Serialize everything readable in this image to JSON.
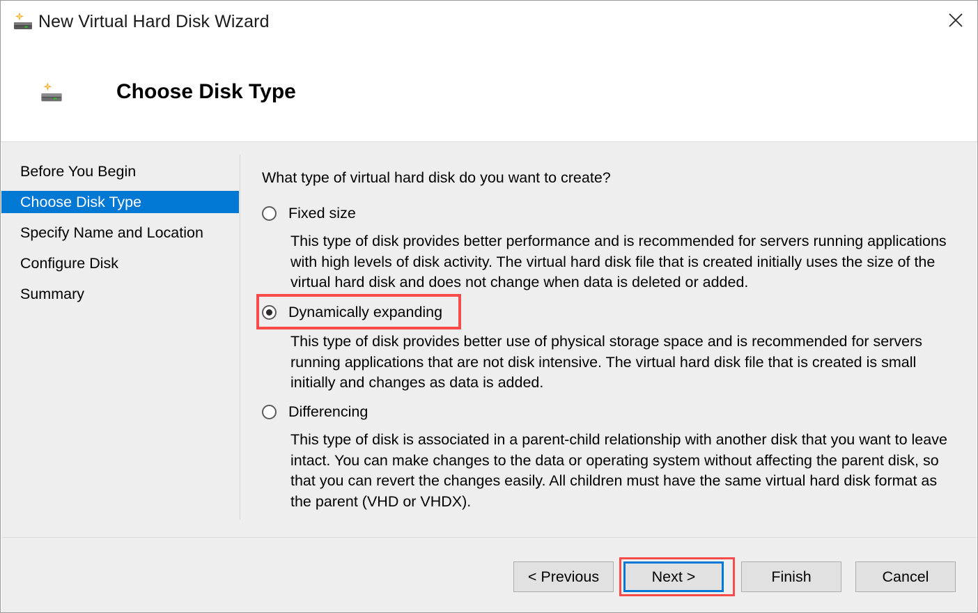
{
  "window": {
    "title": "New Virtual Hard Disk Wizard",
    "icon": "virtual-hard-disk-icon",
    "close_icon": "close-icon"
  },
  "header": {
    "title": "Choose Disk Type",
    "icon": "virtual-hard-disk-icon"
  },
  "sidebar": {
    "items": [
      {
        "label": "Before You Begin",
        "selected": false
      },
      {
        "label": "Choose Disk Type",
        "selected": true
      },
      {
        "label": "Specify Name and Location",
        "selected": false
      },
      {
        "label": "Configure Disk",
        "selected": false
      },
      {
        "label": "Summary",
        "selected": false
      }
    ]
  },
  "main": {
    "question": "What type of virtual hard disk do you want to create?",
    "options": [
      {
        "label": "Fixed size",
        "checked": false,
        "description": "This type of disk provides better performance and is recommended for servers running applications with high levels of disk activity. The virtual hard disk file that is created initially uses the size of the virtual hard disk and does not change when data is deleted or added."
      },
      {
        "label": "Dynamically expanding",
        "checked": true,
        "description": "This type of disk provides better use of physical storage space and is recommended for servers running applications that are not disk intensive. The virtual hard disk file that is created is small initially and changes as data is added."
      },
      {
        "label": "Differencing",
        "checked": false,
        "description": "This type of disk is associated in a parent-child relationship with another disk that you want to leave intact. You can make changes to the data or operating system without affecting the parent disk, so that you can revert the changes easily. All children must have the same virtual hard disk format as the parent (VHD or VHDX)."
      }
    ]
  },
  "footer": {
    "buttons": [
      {
        "label": "< Previous",
        "focused": false
      },
      {
        "label": "Next >",
        "focused": true
      },
      {
        "label": "Finish",
        "focused": false
      },
      {
        "label": "Cancel",
        "focused": false
      }
    ]
  },
  "colors": {
    "selection_blue": "#0078d4",
    "focus_blue": "#0078d7",
    "highlight_red": "#fa4b4b",
    "body_gray": "#eeeeee",
    "button_gray": "#e1e1e1"
  }
}
